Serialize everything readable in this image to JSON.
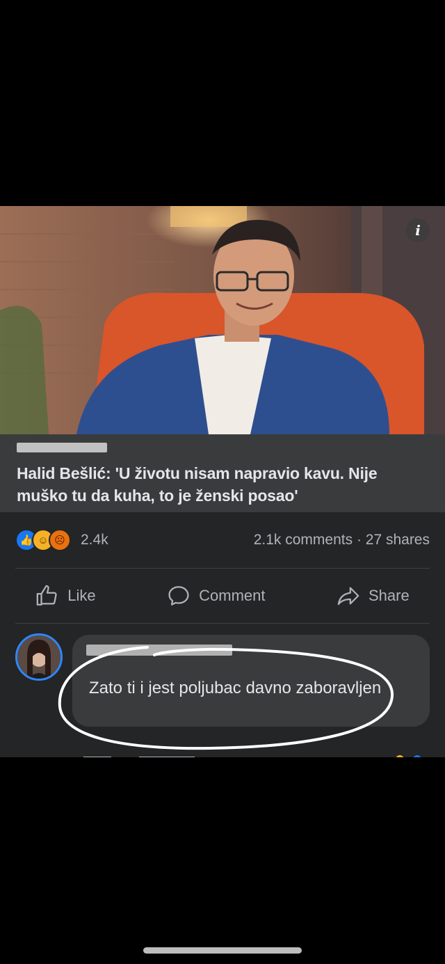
{
  "post": {
    "info_icon_glyph": "i",
    "photo_alt": "",
    "link_title": "Halid Bešlić: 'U životu nisam napravio kavu. Nije muško tu da kuha, to je ženski posao'",
    "reaction_icons": [
      "like-icon",
      "haha-icon",
      "angry-icon"
    ],
    "reaction_count": "2.4k",
    "comments_shares": "2.1k comments · 27 shares",
    "actions": {
      "like": "Like",
      "comment": "Comment",
      "share": "Share"
    }
  },
  "comment": {
    "text": "Zato ti i jest poljubac davno zaboravljen"
  },
  "colors": {
    "background": "#000000",
    "post_bg": "#242526",
    "link_box_bg": "#3a3b3c",
    "text_primary": "#e4e6eb",
    "text_secondary": "#b0b3b8",
    "accent_blue": "#1877f2",
    "annotation_circle": "#ffffff"
  }
}
